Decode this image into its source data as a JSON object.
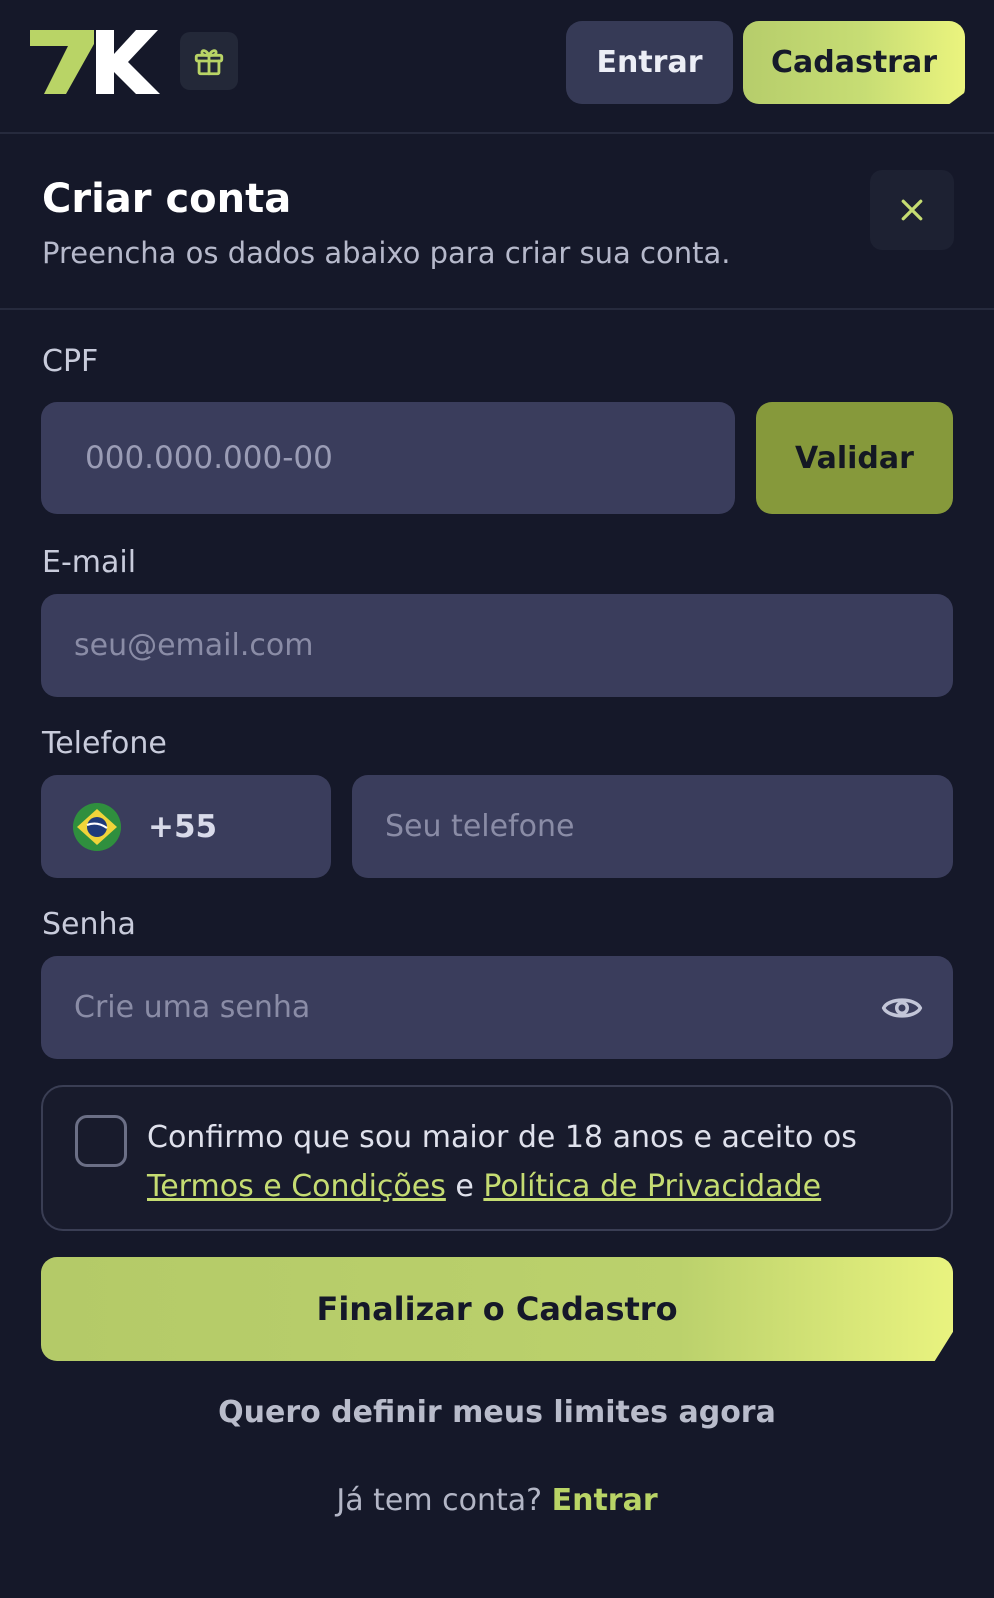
{
  "header": {
    "logo_text": "7K",
    "gift_icon": "gift-icon",
    "login_label": "Entrar",
    "register_label": "Cadastrar"
  },
  "panel": {
    "title": "Criar conta",
    "subtitle": "Preencha os dados abaixo para criar sua conta.",
    "close_icon": "close-icon"
  },
  "form": {
    "cpf": {
      "label": "CPF",
      "placeholder": "000.000.000-00",
      "validate_label": "Validar"
    },
    "email": {
      "label": "E-mail",
      "placeholder": "seu@email.com"
    },
    "phone": {
      "label": "Telefone",
      "country_code": "+55",
      "flag_icon": "brazil-flag-icon",
      "placeholder": "Seu telefone"
    },
    "password": {
      "label": "Senha",
      "placeholder": "Crie uma senha",
      "toggle_icon": "eye-icon"
    },
    "terms": {
      "text_before": "Confirmo que sou maior de 18 anos e aceito os ",
      "terms_link": "Termos e Condições",
      "conjunction": " e ",
      "privacy_link": "Política de Privacidade",
      "checked": false
    },
    "submit_label": "Finalizar o Cadastro",
    "limits_label": "Quero definir meus limites agora",
    "login_prompt": "Já tem conta?",
    "login_link": "Entrar"
  },
  "colors": {
    "background": "#151829",
    "accent": "#c5dc72",
    "input_bg": "#3a3d5c",
    "validate_bg": "#86993b"
  }
}
